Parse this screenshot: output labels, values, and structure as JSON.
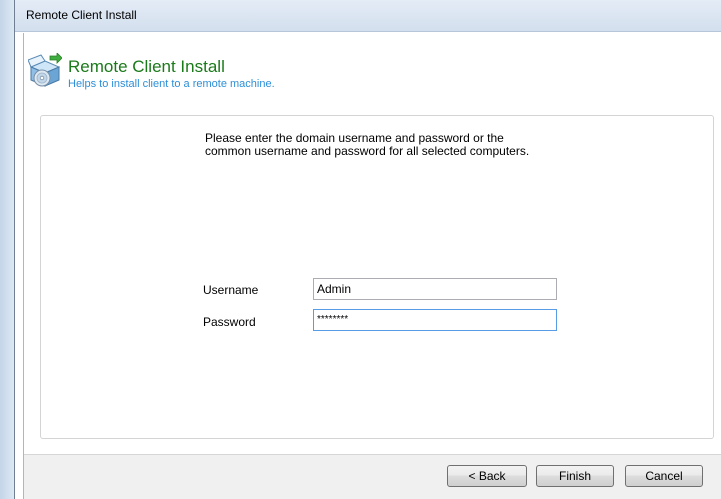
{
  "window": {
    "title": "Remote Client Install"
  },
  "header": {
    "title": "Remote Client Install",
    "subtitle": "Helps to install client to a remote machine.",
    "icon": "install-wizard-icon"
  },
  "form": {
    "instructions_line1": "Please enter the domain username and password or the",
    "instructions_line2": "common username and password for all selected computers.",
    "username_label": "Username",
    "username_value": "Admin",
    "password_label": "Password",
    "password_value": "********"
  },
  "buttons": {
    "back": "< Back",
    "finish": "Finish",
    "cancel": "Cancel"
  },
  "colors": {
    "header_title": "#1a7a1a",
    "header_subtitle": "#2d8fd8",
    "focus_border": "#569de5"
  }
}
